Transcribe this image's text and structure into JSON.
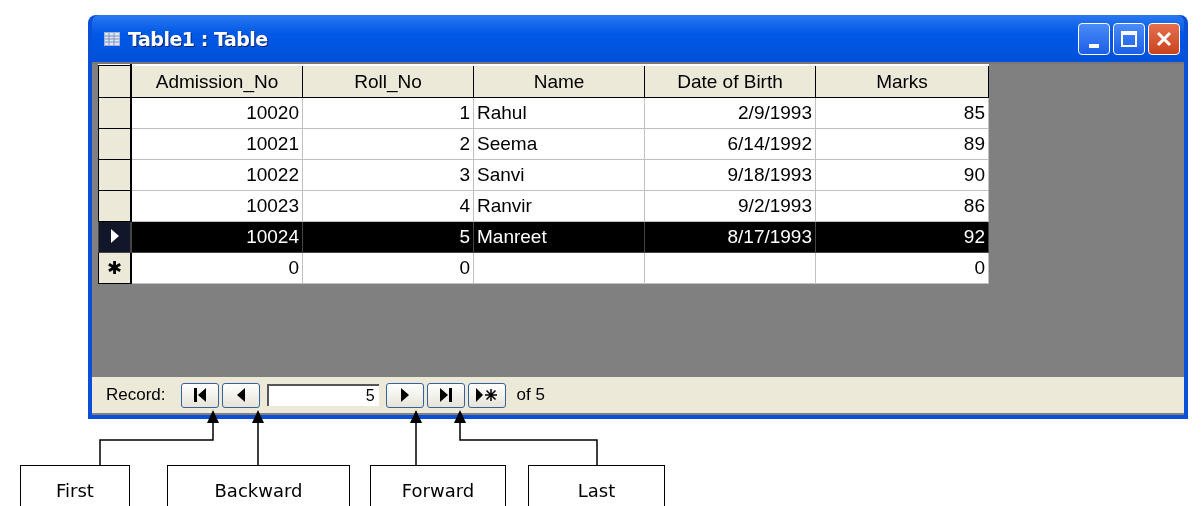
{
  "window": {
    "title": "Table1 : Table"
  },
  "table": {
    "columns": [
      {
        "label": "Admission_No",
        "kind": "number"
      },
      {
        "label": "Roll_No",
        "kind": "number"
      },
      {
        "label": "Name",
        "kind": "text"
      },
      {
        "label": "Date of Birth",
        "kind": "date"
      },
      {
        "label": "Marks",
        "kind": "number"
      }
    ],
    "rows": [
      {
        "kind": "record",
        "selected": false,
        "cells": [
          "10020",
          "1",
          "Rahul",
          "2/9/1993",
          "85"
        ]
      },
      {
        "kind": "record",
        "selected": false,
        "cells": [
          "10021",
          "2",
          "Seema",
          "6/14/1992",
          "89"
        ]
      },
      {
        "kind": "record",
        "selected": false,
        "cells": [
          "10022",
          "3",
          "Sanvi",
          "9/18/1993",
          "90"
        ]
      },
      {
        "kind": "record",
        "selected": false,
        "cells": [
          "10023",
          "4",
          "Ranvir",
          "9/2/1993",
          "86"
        ]
      },
      {
        "kind": "record",
        "selected": true,
        "cells": [
          "10024",
          "5",
          "Manreet",
          "8/17/1993",
          "92"
        ]
      },
      {
        "kind": "new",
        "selected": false,
        "marker": "✱",
        "cells": [
          "0",
          "0",
          "",
          "",
          "0"
        ]
      }
    ]
  },
  "navigation": {
    "label": "Record:",
    "current": "5",
    "total": "of 5"
  },
  "callouts": [
    {
      "label": "First"
    },
    {
      "label": "Backward"
    },
    {
      "label": "Forward"
    },
    {
      "label": "Last"
    }
  ]
}
